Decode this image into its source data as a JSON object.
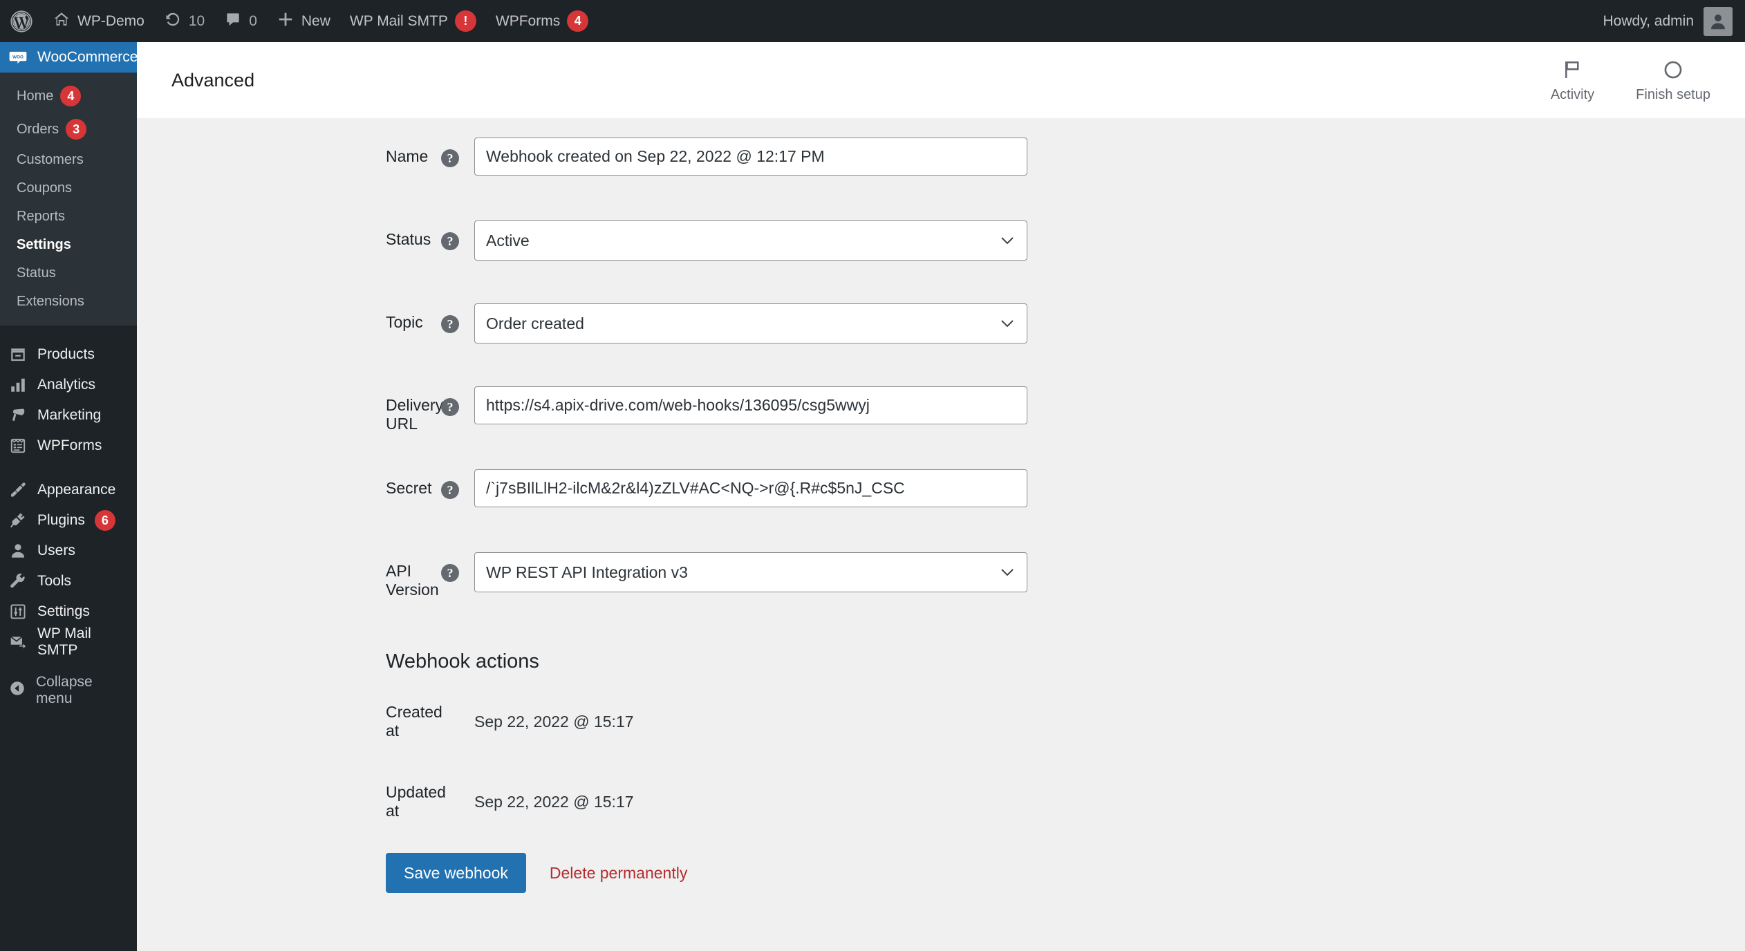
{
  "adminbar": {
    "wp_logo_icon": "wordpress-logo-icon",
    "site": {
      "icon": "home-icon",
      "label": "WP-Demo"
    },
    "updates": {
      "icon": "updates-icon",
      "count": "10"
    },
    "comments": {
      "icon": "comment-icon",
      "count": "0"
    },
    "new": {
      "icon": "plus-icon",
      "label": "New"
    },
    "wp_mail_smtp": {
      "label": "WP Mail SMTP",
      "badge": "!"
    },
    "wpforms": {
      "label": "WPForms",
      "badge": "4"
    },
    "howdy": "Howdy, admin",
    "avatar_icon": "avatar-icon"
  },
  "sidebar": {
    "woocommerce": {
      "label": "WooCommerce",
      "icon": "woocommerce-icon",
      "current": true
    },
    "submenu": [
      {
        "label": "Home",
        "badge": "4",
        "current": false
      },
      {
        "label": "Orders",
        "badge": "3",
        "current": false
      },
      {
        "label": "Customers",
        "badge": "",
        "current": false
      },
      {
        "label": "Coupons",
        "badge": "",
        "current": false
      },
      {
        "label": "Reports",
        "badge": "",
        "current": false
      },
      {
        "label": "Settings",
        "badge": "",
        "current": true
      },
      {
        "label": "Status",
        "badge": "",
        "current": false
      },
      {
        "label": "Extensions",
        "badge": "",
        "current": false
      }
    ],
    "group_a": [
      {
        "label": "Products",
        "icon": "products-icon",
        "badge": ""
      },
      {
        "label": "Analytics",
        "icon": "analytics-icon",
        "badge": ""
      },
      {
        "label": "Marketing",
        "icon": "megaphone-icon",
        "badge": ""
      },
      {
        "label": "WPForms",
        "icon": "wpforms-icon",
        "badge": ""
      }
    ],
    "group_b": [
      {
        "label": "Appearance",
        "icon": "paintbrush-icon",
        "badge": ""
      },
      {
        "label": "Plugins",
        "icon": "plugin-icon",
        "badge": "6"
      },
      {
        "label": "Users",
        "icon": "user-icon",
        "badge": ""
      },
      {
        "label": "Tools",
        "icon": "wrench-icon",
        "badge": ""
      },
      {
        "label": "Settings",
        "icon": "settings-sliders-icon",
        "badge": ""
      },
      {
        "label": "WP Mail SMTP",
        "icon": "mail-forward-icon",
        "badge": ""
      }
    ],
    "collapse": {
      "label": "Collapse menu",
      "icon": "collapse-arrow-icon"
    }
  },
  "header": {
    "title": "Advanced",
    "activity": {
      "label": "Activity",
      "icon": "flag-icon"
    },
    "finish_setup": {
      "label": "Finish setup",
      "icon": "progress-circle-icon"
    }
  },
  "form": {
    "name": {
      "label": "Name",
      "value": "Webhook created on Sep 22, 2022 @ 12:17 PM"
    },
    "status": {
      "label": "Status",
      "value": "Active"
    },
    "topic": {
      "label": "Topic",
      "value": "Order created"
    },
    "delivery_url": {
      "label": "Delivery URL",
      "value": "https://s4.apix-drive.com/web-hooks/136095/csg5wwyj"
    },
    "secret": {
      "label": "Secret",
      "value": "/`j7sBIlLlH2-ilcM&2r&l4)zZLV#AC<NQ->r@{.R#c$5nJ_CSC"
    },
    "api_version": {
      "label": "API Version",
      "value": "WP REST API Integration v3"
    }
  },
  "webhook_actions": {
    "title": "Webhook actions",
    "created_at": {
      "label": "Created at",
      "value": "Sep 22, 2022 @ 15:17"
    },
    "updated_at": {
      "label": "Updated at",
      "value": "Sep 22, 2022 @ 15:17"
    }
  },
  "buttons": {
    "save": "Save webhook",
    "delete": "Delete permanently"
  },
  "colors": {
    "accent": "#2271b1",
    "danger": "#b32d2e",
    "badge": "#d63638",
    "sidebar": "#1d2327",
    "submenu": "#2c3338"
  }
}
